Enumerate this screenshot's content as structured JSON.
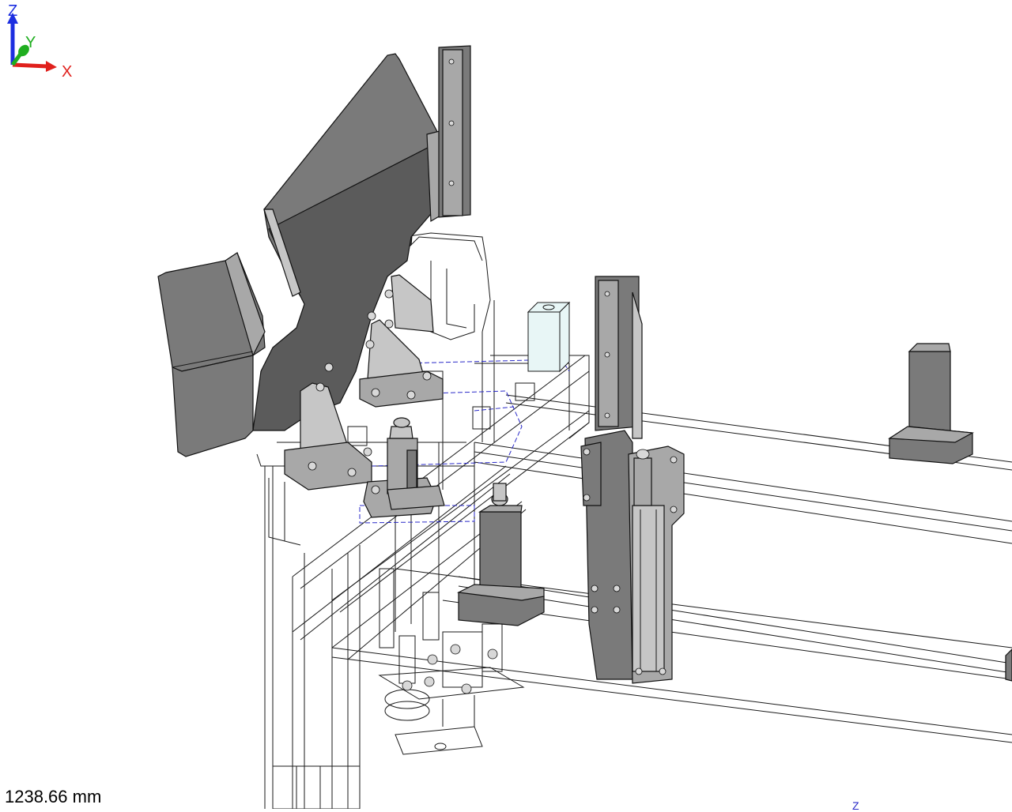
{
  "viewport": {
    "scale_readout": "1238.66 mm",
    "triad": {
      "x_label": "X",
      "y_label": "Y",
      "z_label": "Z"
    },
    "bottom_glyph": "Z",
    "colors": {
      "background": "#ffffff",
      "x_axis": "#e0201c",
      "y_axis": "#1fae1f",
      "z_axis": "#1c2ee0",
      "hidden_lines": "#2a2ac8",
      "solid_dark": "#5b5b5b",
      "solid_mid": "#7a7a7a",
      "solid_light": "#a8a8a8"
    }
  }
}
